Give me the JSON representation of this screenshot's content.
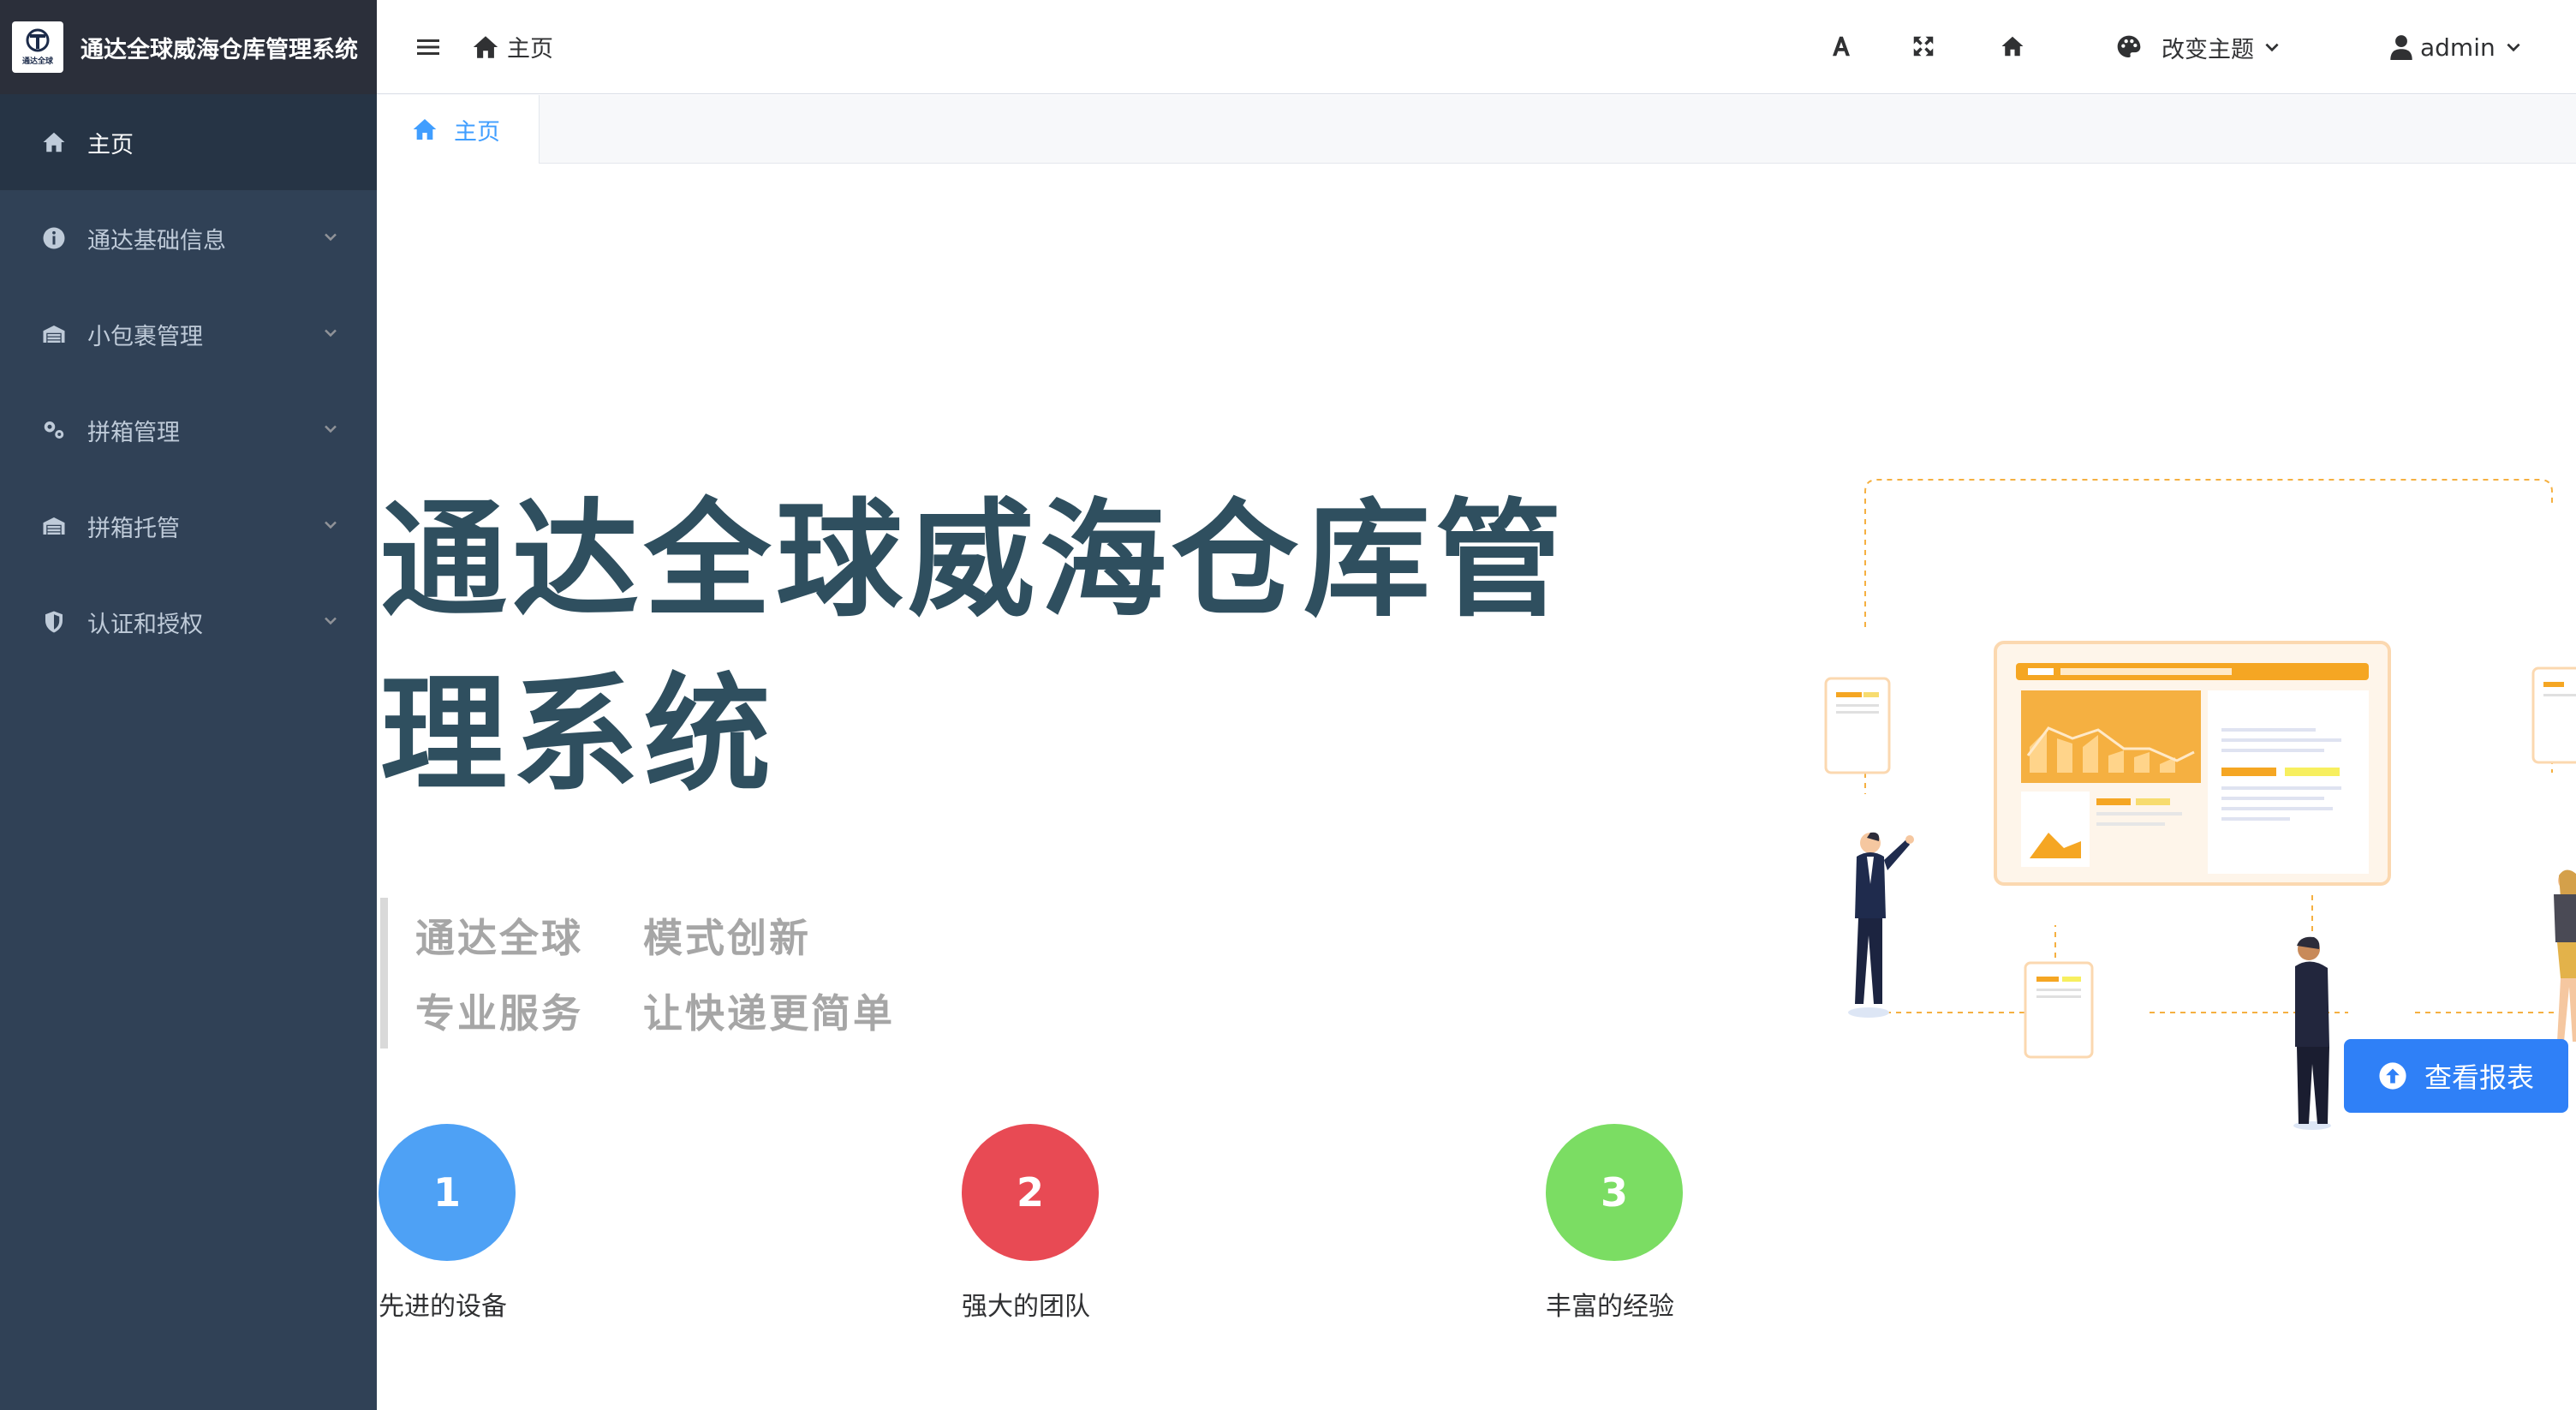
{
  "app": {
    "logo_text": "通达全球",
    "title": "通达全球威海仓库管理系统"
  },
  "sidebar": {
    "items": [
      {
        "label": "主页",
        "icon": "home-icon",
        "active": true
      },
      {
        "label": "通达基础信息",
        "icon": "info-icon",
        "expandable": true
      },
      {
        "label": "小包裹管理",
        "icon": "warehouse-icon",
        "expandable": true
      },
      {
        "label": "拼箱管理",
        "icon": "gears-icon",
        "expandable": true
      },
      {
        "label": "拼箱托管",
        "icon": "warehouse-icon",
        "expandable": true
      },
      {
        "label": "认证和授权",
        "icon": "shield-icon",
        "expandable": true
      }
    ]
  },
  "navbar": {
    "breadcrumb": "主页",
    "theme_label": "改变主题",
    "user_label": "admin"
  },
  "tags_view": {
    "active_tag": "主页"
  },
  "main": {
    "hero_title": "通达全球威海仓库管理系统",
    "slogans": {
      "row1": [
        "通达全球",
        "模式创新"
      ],
      "row2": [
        "专业服务",
        "让快递更简单"
      ]
    },
    "features": [
      {
        "number": "1",
        "label": "先进的设备",
        "color": "#4ea1f5"
      },
      {
        "number": "2",
        "label": "强大的团队",
        "color": "#e84a54"
      },
      {
        "number": "3",
        "label": "丰富的经验",
        "color": "#7bdd63"
      }
    ],
    "report_button": "查看报表"
  },
  "colors": {
    "sidebar_bg": "#304156",
    "sidebar_active_bg": "#263445",
    "accent": "#409eff",
    "hero_text": "#2f4f5f",
    "button_blue": "#2f80f7"
  }
}
